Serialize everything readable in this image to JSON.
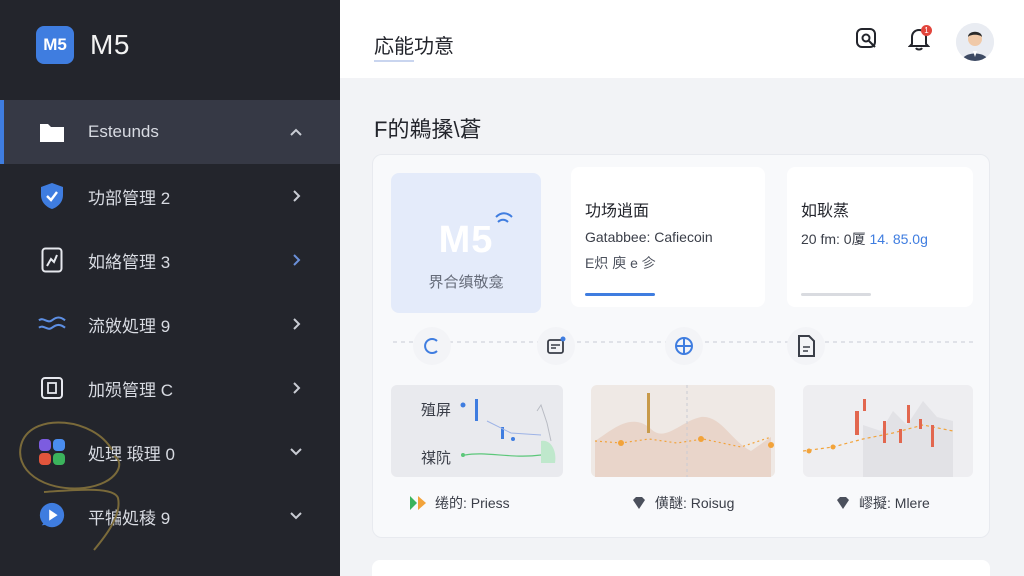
{
  "app": {
    "logo_text": "M5",
    "title": "M5"
  },
  "sidebar": {
    "items": [
      {
        "label": "Esteunds",
        "icon": "folder-icon",
        "active": true,
        "chevron": "up"
      },
      {
        "label": "功部管理 2",
        "icon": "shield-check-icon",
        "chevron": "right"
      },
      {
        "label": "如絡管理 3",
        "icon": "document-chart-icon",
        "chevron": "right"
      },
      {
        "label": "流敓処理 9",
        "icon": "flow-icon",
        "chevron": "right"
      },
      {
        "label": "加殒管理 C",
        "icon": "doc-frame-icon",
        "chevron": "right"
      },
      {
        "label": "処理 瑖理 0",
        "icon": "apps-grid-icon",
        "chevron": "down"
      },
      {
        "label": "平犏処稜 9",
        "icon": "play-bubble-icon",
        "chevron": "down"
      }
    ]
  },
  "header": {
    "title": "応能功意",
    "notification_count": "1"
  },
  "section": {
    "title": "F的鵜搡\\蒼"
  },
  "hero": {
    "big_text": "M5",
    "subtitle": "界合缜敬龛"
  },
  "cards": [
    {
      "title": "功场逍面",
      "line1": "Gatabbee: Cafiecoin",
      "line2": "E炽 庾 e 㐱",
      "accent": "#3f7de0"
    },
    {
      "title": "如耿蒸",
      "line1_prefix": "20 fm: 0厦",
      "line1_value": "14. 85.0g",
      "accent": "#d9dbe0"
    }
  ],
  "charts": {
    "left_labels": [
      "殖屏",
      "禖阬"
    ],
    "captions": [
      "绻的: Priess",
      "僙醚: Roisug",
      "嵺擬: Mlere"
    ]
  },
  "colors": {
    "accent": "#3f7de0",
    "sidebar_bg": "#23252c",
    "red": "#e2453c",
    "orange": "#f2a33a"
  }
}
